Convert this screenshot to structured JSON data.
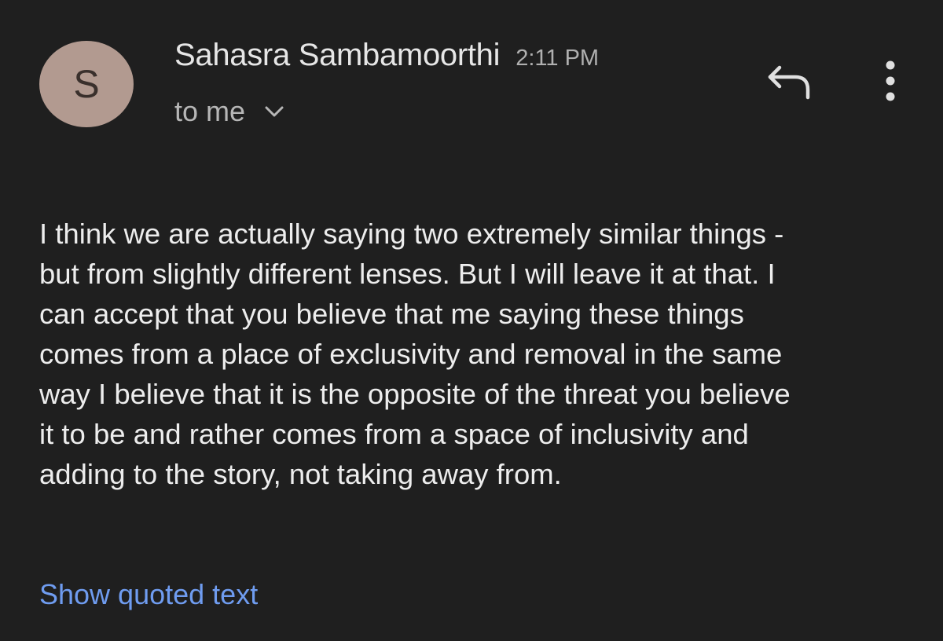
{
  "header": {
    "avatar_letter": "S",
    "avatar_color": "#b29a90",
    "sender_name": "Sahasra Sambamoorthi",
    "timestamp": "2:11 PM",
    "recipient": "to me",
    "recipient_toggle_icon": "chevron-down-icon",
    "reply_icon": "reply-icon",
    "more_icon": "more-vert-icon"
  },
  "message": {
    "lines": [
      "I think we are actually saying two extremely similar things -",
      "but from slightly different lenses. But I will leave it at that. I",
      "can accept that you believe that me saying these things",
      "comes from a place of exclusivity and removal in the same",
      "way I believe that it is the opposite of the threat you believe",
      "it to be and rather comes from a space of inclusivity and",
      "adding to the story, not taking away from."
    ]
  },
  "footer": {
    "show_quoted_label": "Show quoted text",
    "link_color": "#6f9cf0"
  },
  "theme": {
    "background": "#1f1f1f",
    "text": "#ededed",
    "secondary_text": "#b0b0b0"
  }
}
